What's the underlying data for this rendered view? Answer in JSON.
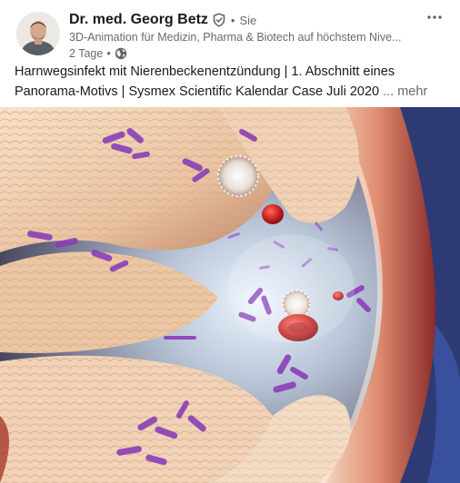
{
  "post": {
    "author": {
      "name": "Dr. med. Georg Betz",
      "degree": "Sie",
      "headline": "3D-Animation für Medizin, Pharma & Biotech auf höchstem Nive...",
      "timestamp": "2 Tage",
      "visibility_icon": "globe-icon"
    },
    "text": "Harnwegsinfekt mit Nierenbeckenentzündung | 1. Abschnitt eines Panorama-Motivs | Sysmex Scientific Kalendar Case Juli 2020",
    "see_more": "... mehr",
    "menu_icon": "more-horizontal-icon"
  },
  "colors": {
    "text_primary": "#1d1d1d",
    "text_secondary": "#666666",
    "tissue": "#f3d9c0",
    "bacteria": "#8a3fb8",
    "blood_cell": "#c41f1f"
  }
}
